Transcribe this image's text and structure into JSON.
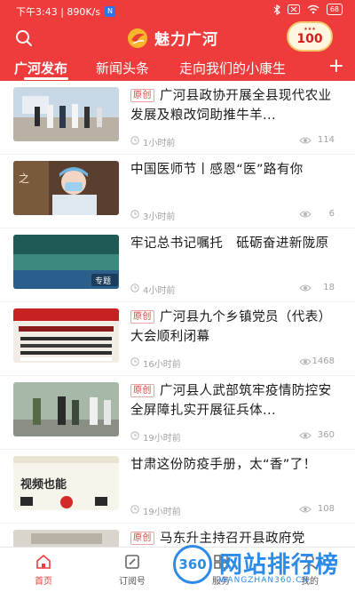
{
  "status_bar": {
    "time_speed": "下午3:43 | 890K/s",
    "battery": "68"
  },
  "app": {
    "logo_text": "魅力广河",
    "badge_number": "100"
  },
  "tabs": [
    {
      "label": "广河发布",
      "active": true
    },
    {
      "label": "新闻头条",
      "active": false
    },
    {
      "label": "走向我们的小康生",
      "active": false
    }
  ],
  "tab_add": "+",
  "news": [
    {
      "original": "原创",
      "title": "广河县政协开展全县现代农业发展及粮改饲助推牛羊...",
      "time": "1小时前",
      "views": "114",
      "thumb_text": ""
    },
    {
      "original": "",
      "title": "中国医师节丨感恩“医”路有你",
      "time": "3小时前",
      "views": "6",
      "thumb_text": ""
    },
    {
      "original": "",
      "title": "牢记总书记嘱托　砥砺奋进新陇原",
      "time": "4小时前",
      "views": "18",
      "thumb_text": "专题"
    },
    {
      "original": "原创",
      "title": "广河县九个乡镇党员（代表）大会顺利闭幕",
      "time": "16小时前",
      "views": "1468",
      "thumb_text": ""
    },
    {
      "original": "原创",
      "title": "广河县人武部筑牢疫情防控安全屏障扎实开展征兵体...",
      "time": "19小时前",
      "views": "360",
      "thumb_text": ""
    },
    {
      "original": "",
      "title": "甘肃这份防疫手册，太“香”了！",
      "time": "19小时前",
      "views": "108",
      "thumb_text": "视频也能"
    },
    {
      "original": "原创",
      "title": "马东升主持召开县政府党",
      "time": "",
      "views": "",
      "thumb_text": ""
    }
  ],
  "bottom_nav": [
    {
      "label": "首页",
      "icon": "home-icon",
      "active": true
    },
    {
      "label": "订阅号",
      "icon": "subscribe-icon",
      "active": false
    },
    {
      "label": "服务",
      "icon": "service-icon",
      "active": false
    },
    {
      "label": "我的",
      "icon": "profile-icon",
      "active": false
    }
  ],
  "watermark": {
    "circle": "360",
    "text": "网站排行榜",
    "url": "WANGZHAN360.CN"
  },
  "colors": {
    "brand_red": "#ee3b3b",
    "watermark_blue": "#2c8be8"
  }
}
